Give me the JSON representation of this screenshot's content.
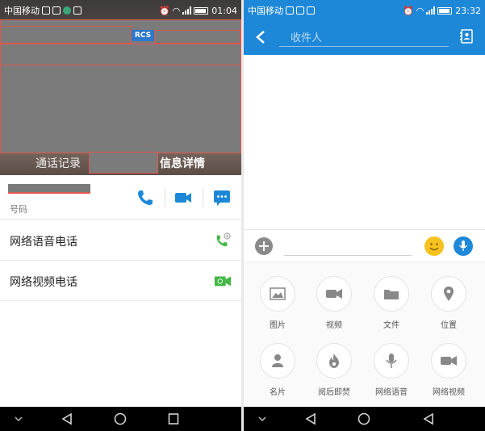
{
  "left_screen": {
    "status": {
      "carrier": "中国移动",
      "time": "01:04"
    },
    "hero": {
      "badge": "RCS",
      "tab_call_log": "通话记录",
      "tab_info_detail": "信息详情"
    },
    "contact": {
      "number_label": "号码"
    },
    "options": [
      {
        "label": "网络语音电话"
      },
      {
        "label": "网络视频电话"
      }
    ]
  },
  "right_screen": {
    "status": {
      "carrier": "中国移动",
      "time": "23:32"
    },
    "recipient_placeholder": "收件人",
    "attachments": [
      {
        "label": "图片"
      },
      {
        "label": "视频"
      },
      {
        "label": "文件"
      },
      {
        "label": "位置"
      },
      {
        "label": "名片"
      },
      {
        "label": "阅后即焚"
      },
      {
        "label": "网络语音"
      },
      {
        "label": "网络视频"
      }
    ]
  },
  "colors": {
    "accent_blue": "#1e88d8",
    "call_green": "#43b843",
    "emoji_yellow": "#f6c21e",
    "mask_gray": "#7b7b7b",
    "mask_border_red": "#e0574f"
  }
}
